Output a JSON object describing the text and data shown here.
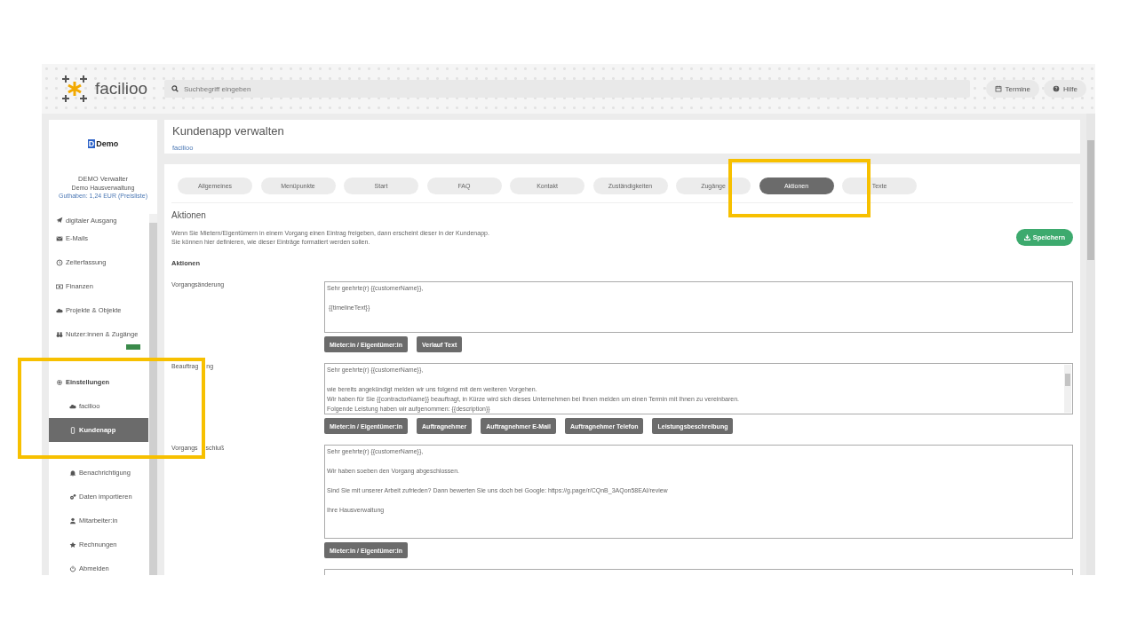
{
  "logo": {
    "text": "facilioo"
  },
  "search": {
    "placeholder": "Suchbegriff eingeben"
  },
  "header_buttons": [
    {
      "label": "Termine",
      "kind": "calendar"
    },
    {
      "label": "Hilfe",
      "kind": "help"
    }
  ],
  "sidebar": {
    "brand_mark": "D",
    "brand": "Demo",
    "user_name": "DEMO Verwalter",
    "company": "Demo Hausverwaltung",
    "balance": "Guthaben: 1,24 EUR",
    "price_link": "(Preisliste)",
    "items": [
      {
        "label": "digitaler Ausgang",
        "kind": "plane",
        "selected": false
      },
      {
        "label": "E-Mails",
        "kind": "mail",
        "selected": false
      },
      {
        "label": "Zeiterfassung",
        "kind": "clock",
        "selected": false
      },
      {
        "label": "Finanzen",
        "kind": "money",
        "selected": false
      },
      {
        "label": "Projekte & Objekte",
        "kind": "cloud",
        "selected": false
      },
      {
        "label": "Nutzer:innen & Zugänge",
        "kind": "binoculars",
        "selected": false
      },
      {
        "label": "Einstellungen",
        "kind": "gear",
        "selected": false,
        "children": [
          {
            "label": "facilioo",
            "kind": "cloud",
            "selected": false
          },
          {
            "label": "Kundenapp",
            "kind": "phone",
            "selected": true
          },
          {
            "label": "Benachrichtigung",
            "kind": "bell",
            "selected": false
          },
          {
            "label": "Daten importieren",
            "kind": "gears",
            "selected": false
          },
          {
            "label": "Mitarbeiter:in",
            "kind": "user",
            "selected": false
          },
          {
            "label": "Rechnungen",
            "kind": "star",
            "selected": false
          },
          {
            "label": "Abmelden",
            "kind": "power",
            "selected": false
          }
        ]
      }
    ]
  },
  "page": {
    "title": "Kundenapp verwalten",
    "breadcrumb": "facilioo"
  },
  "tabs": [
    {
      "label": "Allgemeines",
      "selected": false
    },
    {
      "label": "Menüpunkte",
      "selected": false
    },
    {
      "label": "Start",
      "selected": false
    },
    {
      "label": "FAQ",
      "selected": false
    },
    {
      "label": "Kontakt",
      "selected": false
    },
    {
      "label": "Zuständigkeiten",
      "selected": false
    },
    {
      "label": "Zugänge",
      "selected": false
    },
    {
      "label": "Aktionen",
      "selected": true
    },
    {
      "label": "Texte",
      "selected": false
    }
  ],
  "section": {
    "title": "Aktionen",
    "description": [
      "Wenn Sie Mietern/Eigentümern in einem Vorgang einen Eintrag freigeben, dann erscheint dieser in der Kundenapp.",
      "Sie können hier definieren, wie dieser Einträge formatiert werden sollen."
    ],
    "save_button": "Speichern",
    "subheading": "Aktionen"
  },
  "templates": [
    {
      "label": [
        "Vorgangsänderung"
      ],
      "text": "Sehr geehrte(r) {{customerName}},\n\n {{timelineText}}",
      "buttons": [
        "Mieter:in / Eigentümer:in",
        "Verlauf Text"
      ]
    },
    {
      "label": [
        "Beauftrag",
        "ng"
      ],
      "text": "Sehr geehrte(r) {{customerName}},\n\nwie bereits angekündigt melden wir uns folgend mit dem weiteren Vorgehen.\nWir haben für Sie {{contractorName}} beauftragt, in Kürze wird sich dieses Unternehmen bei Ihnen melden um einen Termin mit Ihnen zu vereinbaren.\nFolgende Leistung haben wir aufgenommen: {{description}}",
      "buttons": [
        "Mieter:in / Eigentümer:in",
        "Auftragnehmer",
        "Auftragnehmer E-Mail",
        "Auftragnehmer Telefon",
        "Leistungsbeschreibung"
      ]
    },
    {
      "label": [
        "Vorgangs",
        "schluß"
      ],
      "text": "Sehr geehrte(r) {{customerName}},\n\nWir haben soeben den Vorgang abgeschlossen.\n\nSind Sie mit unserer Arbeit zufrieden? Dann bewerten Sie uns doch bei Google: https://g.page/r/CQnB_3AQon58EAI/review\n\nIhre Hausverwaltung",
      "buttons": [
        "Mieter:in / Eigentümer:in"
      ]
    }
  ]
}
